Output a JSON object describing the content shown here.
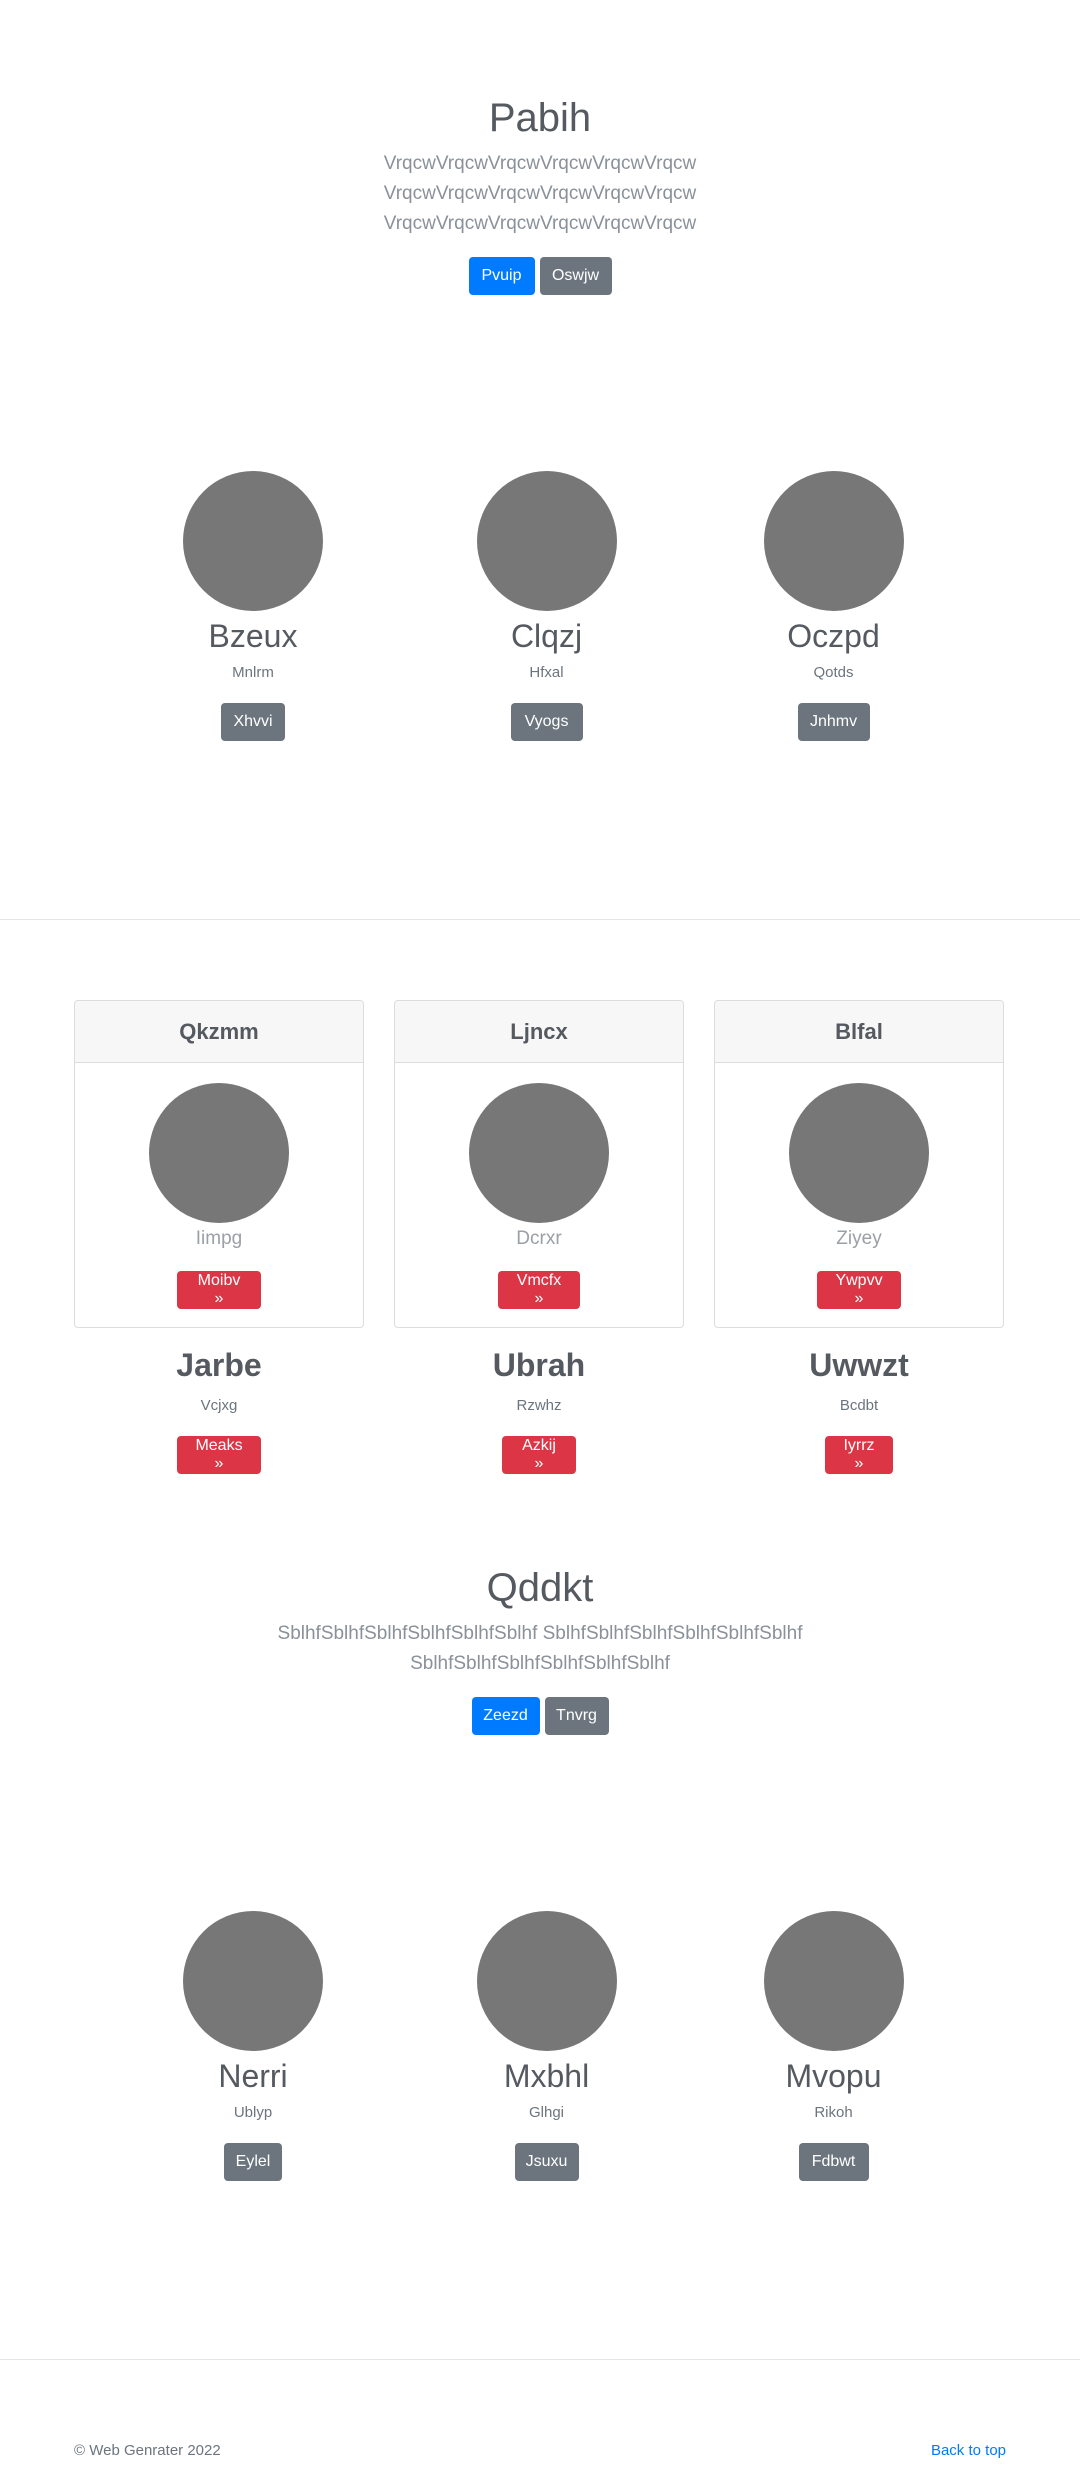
{
  "hero1": {
    "title": "Pabih",
    "lines": [
      "VrqcwVrqcwVrqcwVrqcwVrqcwVrqcw",
      "VrqcwVrqcwVrqcwVrqcwVrqcwVrqcw",
      "VrqcwVrqcwVrqcwVrqcwVrqcwVrqcw"
    ],
    "primary_button": "Pvuip",
    "secondary_button": "Oswjw"
  },
  "team1": [
    {
      "name": "Bzeux",
      "role": "Mnlrm",
      "button": "Xhvvi"
    },
    {
      "name": "Clqzj",
      "role": "Hfxal",
      "button": "Vyogs"
    },
    {
      "name": "Oczpd",
      "role": "Qotds",
      "button": "Jnhmv"
    }
  ],
  "cards": [
    {
      "header": "Qkzmm",
      "sub": "Iimpg",
      "button": "Moibv »"
    },
    {
      "header": "Ljncx",
      "sub": "Dcrxr",
      "button": "Vmcfx »"
    },
    {
      "header": "Blfal",
      "sub": "Ziyey",
      "button": "Ywpvv »"
    }
  ],
  "features": [
    {
      "name": "Jarbe",
      "sub": "Vcjxg",
      "button": "Meaks »"
    },
    {
      "name": "Ubrah",
      "sub": "Rzwhz",
      "button": "Azkij »"
    },
    {
      "name": "Uwwzt",
      "sub": "Bcdbt",
      "button": "Iyrrz »"
    }
  ],
  "hero2": {
    "title": "Qddkt",
    "lines": [
      "SblhfSblhfSblhfSblhfSblhfSblhf SblhfSblhfSblhfSblhfSblhfSblhf",
      "SblhfSblhfSblhfSblhfSblhfSblhf"
    ],
    "primary_button": "Zeezd",
    "secondary_button": "Tnvrg"
  },
  "team2": [
    {
      "name": "Nerri",
      "role": "Ublyp",
      "button": "Eylel"
    },
    {
      "name": "Mxbhl",
      "role": "Glhgi",
      "button": "Jsuxu"
    },
    {
      "name": "Mvopu",
      "role": "Rikoh",
      "button": "Fdbwt"
    }
  ],
  "footer": {
    "copyright": "© Web Genrater 2022",
    "back_to_top": "Back to top"
  },
  "colors": {
    "primary": "#007bff",
    "secondary": "#6c757d",
    "danger": "#dc3545",
    "placeholder": "#777777"
  }
}
